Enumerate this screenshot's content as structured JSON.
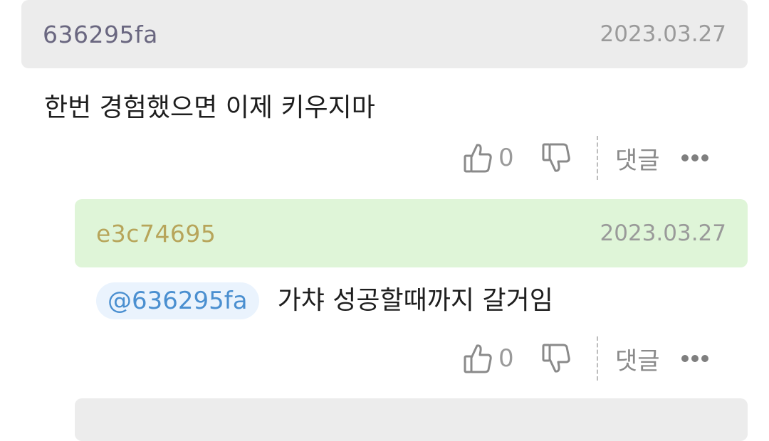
{
  "comments": [
    {
      "author": "636295fa",
      "date": "2023.03.27",
      "text": "한번 경험했으면 이제 키우지마",
      "likes": "0",
      "reply_label": "댓글"
    },
    {
      "author": "e3c74695",
      "date": "2023.03.27",
      "mention": "@636295fa",
      "text": "가챠 성공할때까지 갈거임",
      "likes": "0",
      "reply_label": "댓글"
    }
  ],
  "colors": {
    "header_gray": "#ececec",
    "header_green": "#dff5d8",
    "mention_bg": "#eaf3fd",
    "mention_text": "#4a8fd0"
  }
}
